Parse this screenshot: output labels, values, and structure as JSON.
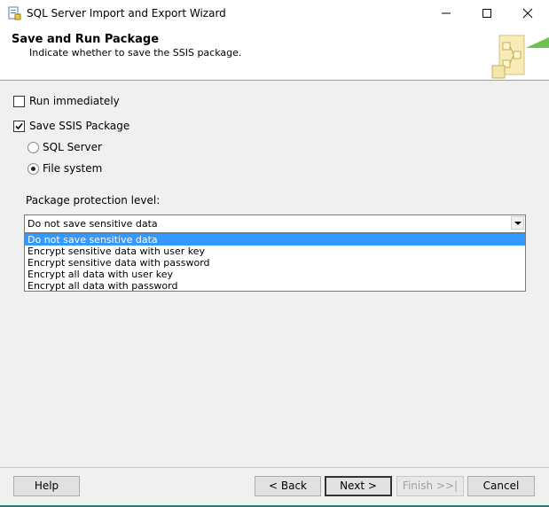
{
  "window": {
    "title": "SQL Server Import and Export Wizard",
    "controls": [
      "minimize",
      "maximize",
      "close"
    ]
  },
  "header": {
    "title": "Save and Run Package",
    "subtitle": "Indicate whether to save the SSIS package."
  },
  "options": {
    "run_immediately": {
      "label": "Run immediately",
      "checked": false
    },
    "save_ssis_package": {
      "label": "Save SSIS Package",
      "checked": true
    },
    "sql_server": {
      "label": "SQL Server",
      "selected": false
    },
    "file_system": {
      "label": "File system",
      "selected": true
    }
  },
  "protection": {
    "label": "Package protection level:",
    "selected": "Do not save sensitive data",
    "options": [
      "Do not save sensitive data",
      "Encrypt sensitive data with user key",
      "Encrypt sensitive data with password",
      "Encrypt all data with user key",
      "Encrypt all data with password"
    ],
    "highlighted_index": 0
  },
  "buttons": {
    "help": "Help",
    "back": "< Back",
    "next": "Next >",
    "finish": "Finish >>|",
    "cancel": "Cancel"
  },
  "colors": {
    "highlight": "#3399ff",
    "accent_green": "#6cc24a"
  }
}
